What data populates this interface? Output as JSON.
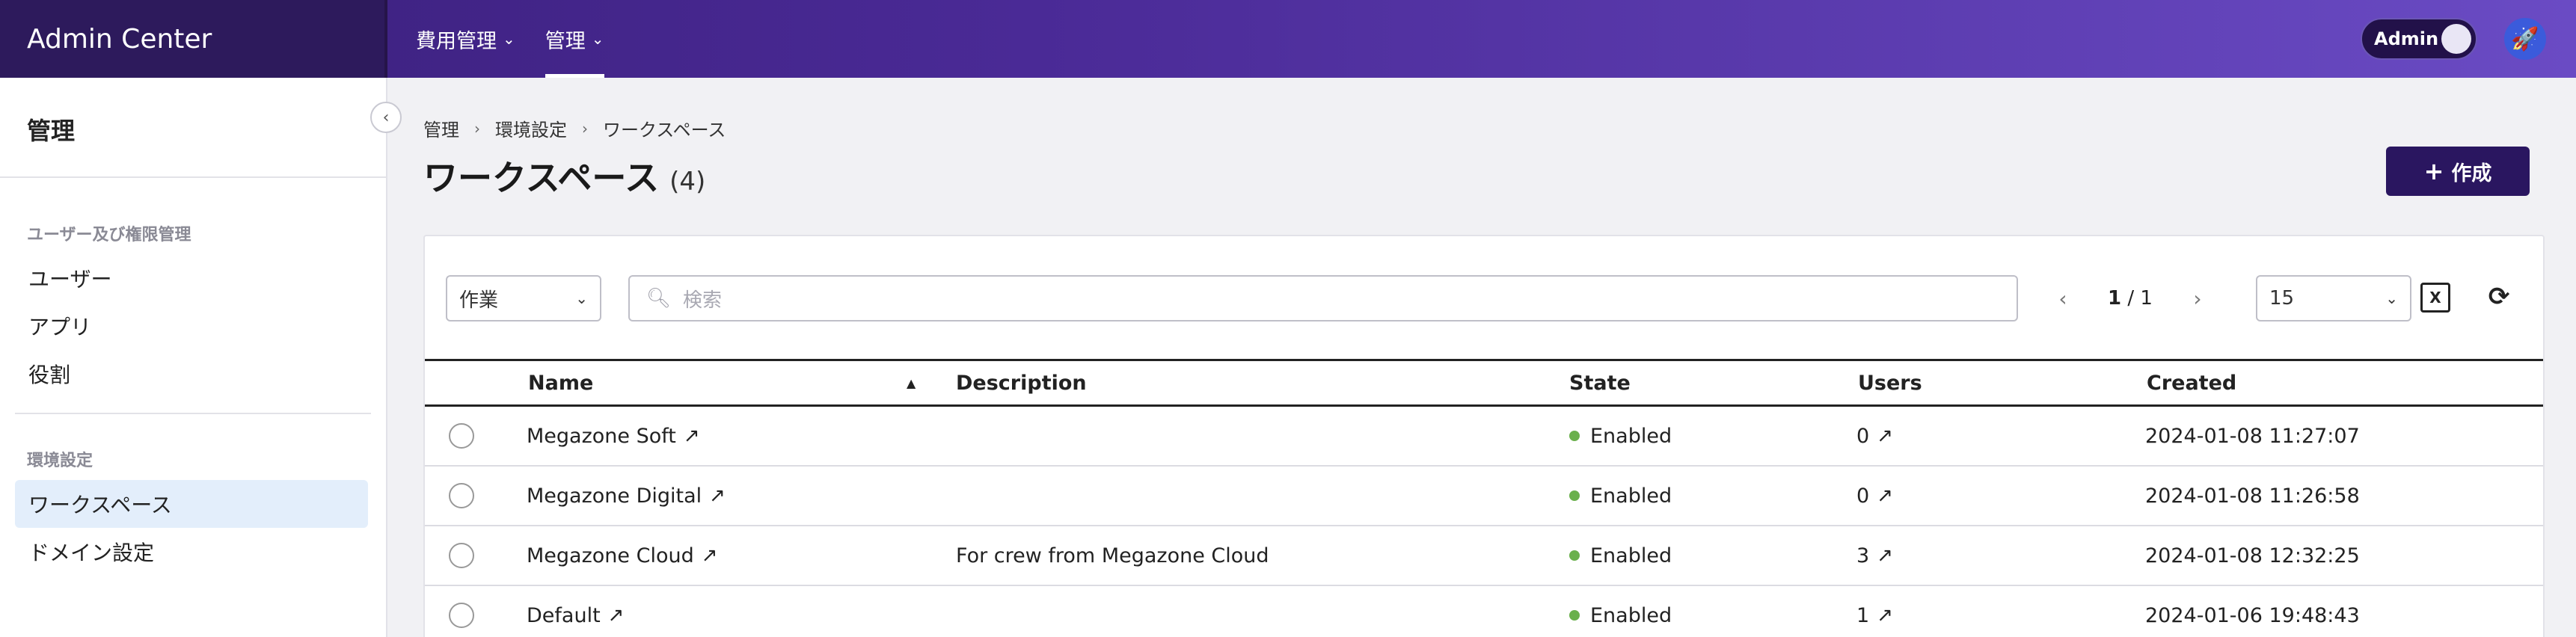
{
  "app": {
    "title": "Admin Center"
  },
  "topnav": {
    "items": [
      {
        "label": "費用管理"
      },
      {
        "label": "管理"
      }
    ],
    "admin_toggle_label": "Admin"
  },
  "sidebar": {
    "title": "管理",
    "sections": [
      {
        "label": "ユーザー及び権限管理",
        "items": [
          {
            "label": "ユーザー"
          },
          {
            "label": "アプリ"
          },
          {
            "label": "役割"
          }
        ]
      },
      {
        "label": "環境設定",
        "items": [
          {
            "label": "ワークスペース"
          },
          {
            "label": "ドメイン設定"
          }
        ]
      }
    ]
  },
  "breadcrumb": [
    "管理",
    "環境設定",
    "ワークスペース"
  ],
  "page": {
    "title": "ワークスペース",
    "count": "(4)",
    "create_label": "作成"
  },
  "toolbar": {
    "action_select": "作業",
    "search_placeholder": "検索",
    "page_current": "1",
    "page_total": "/ 1",
    "page_size": "15"
  },
  "table": {
    "columns": [
      "Name",
      "Description",
      "State",
      "Users",
      "Created"
    ],
    "rows": [
      {
        "name": "Megazone Soft",
        "description": "",
        "state": "Enabled",
        "users": "0",
        "created": "2024-01-08 11:27:07"
      },
      {
        "name": "Megazone Digital",
        "description": "",
        "state": "Enabled",
        "users": "0",
        "created": "2024-01-08 11:26:58"
      },
      {
        "name": "Megazone Cloud",
        "description": "For crew from Megazone Cloud",
        "state": "Enabled",
        "users": "3",
        "created": "2024-01-08 12:32:25"
      },
      {
        "name": "Default",
        "description": "",
        "state": "Enabled",
        "users": "1",
        "created": "2024-01-06 19:48:43"
      }
    ]
  },
  "colors": {
    "topbar_dark": "#2d1a5c",
    "accent": "#2a1660",
    "enabled_dot": "#6ab04c",
    "active_sidebar": "#e3eefb"
  }
}
